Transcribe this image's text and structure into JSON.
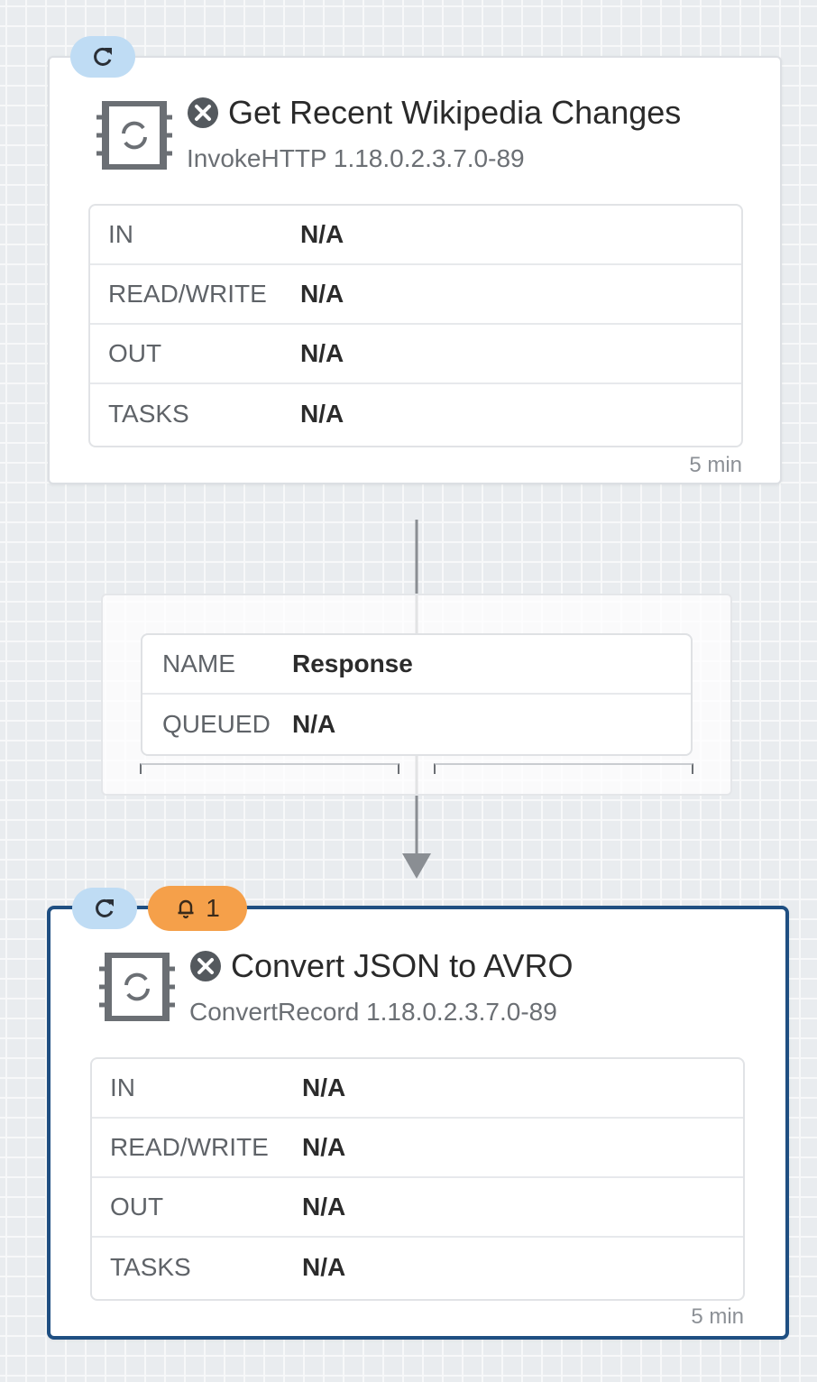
{
  "processors": [
    {
      "title": "Get Recent Wikipedia Changes",
      "subtitle": "InvokeHTTP 1.18.0.2.3.7.0-89",
      "status": "error",
      "run_icon": "refresh-icon",
      "stats": [
        {
          "label": "IN",
          "value": "N/A"
        },
        {
          "label": "READ/WRITE",
          "value": "N/A"
        },
        {
          "label": "OUT",
          "value": "N/A"
        },
        {
          "label": "TASKS",
          "value": "N/A"
        }
      ],
      "period": "5 min"
    },
    {
      "title": "Convert JSON to AVRO",
      "subtitle": "ConvertRecord 1.18.0.2.3.7.0-89",
      "status": "error",
      "run_icon": "refresh-icon",
      "bulletin_count": "1",
      "stats": [
        {
          "label": "IN",
          "value": "N/A"
        },
        {
          "label": "READ/WRITE",
          "value": "N/A"
        },
        {
          "label": "OUT",
          "value": "N/A"
        },
        {
          "label": "TASKS",
          "value": "N/A"
        }
      ],
      "period": "5 min"
    }
  ],
  "connection": {
    "rows": [
      {
        "label": "NAME",
        "value": "Response"
      },
      {
        "label": "QUEUED",
        "value": "N/A"
      }
    ]
  },
  "colors": {
    "selected_border": "#1f4f82",
    "run_badge": "#bfdcf4",
    "bulletin_badge": "#f5a04a",
    "error_icon": "#54595e"
  }
}
